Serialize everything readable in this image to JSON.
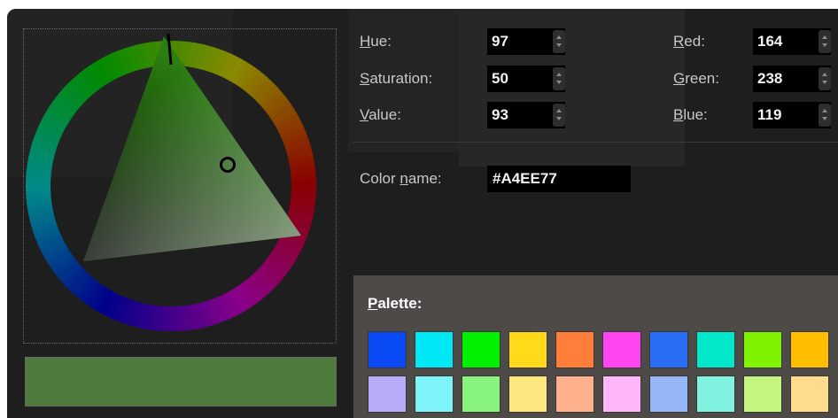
{
  "hsv": {
    "hue_label": "Hue:",
    "hue_value": "97",
    "saturation_label": "Saturation:",
    "saturation_value": "50",
    "value_label": "Value:",
    "value_value": "93"
  },
  "rgb": {
    "red_label": "Red:",
    "red_value": "164",
    "green_label": "Green:",
    "green_value": "238",
    "blue_label": "Blue:",
    "blue_value": "119"
  },
  "color_name": {
    "label": "Color name:",
    "value": "#A4EE77"
  },
  "current_color": "#4e7a3c",
  "palette": {
    "label": "Palette:",
    "row1": [
      "#0a4af5",
      "#00e8f5",
      "#00f000",
      "#ffd91a",
      "#ff7f3a",
      "#ff44f2",
      "#2a6df5",
      "#00e8c9",
      "#7ef200",
      "#ffbf00"
    ],
    "row2": [
      "#b8acfa",
      "#7ff3fa",
      "#89f37f",
      "#ffe77f",
      "#ffb08d",
      "#ffb6fa",
      "#96b6fa",
      "#7ff3e0",
      "#c4f57f",
      "#ffdc8d"
    ]
  }
}
